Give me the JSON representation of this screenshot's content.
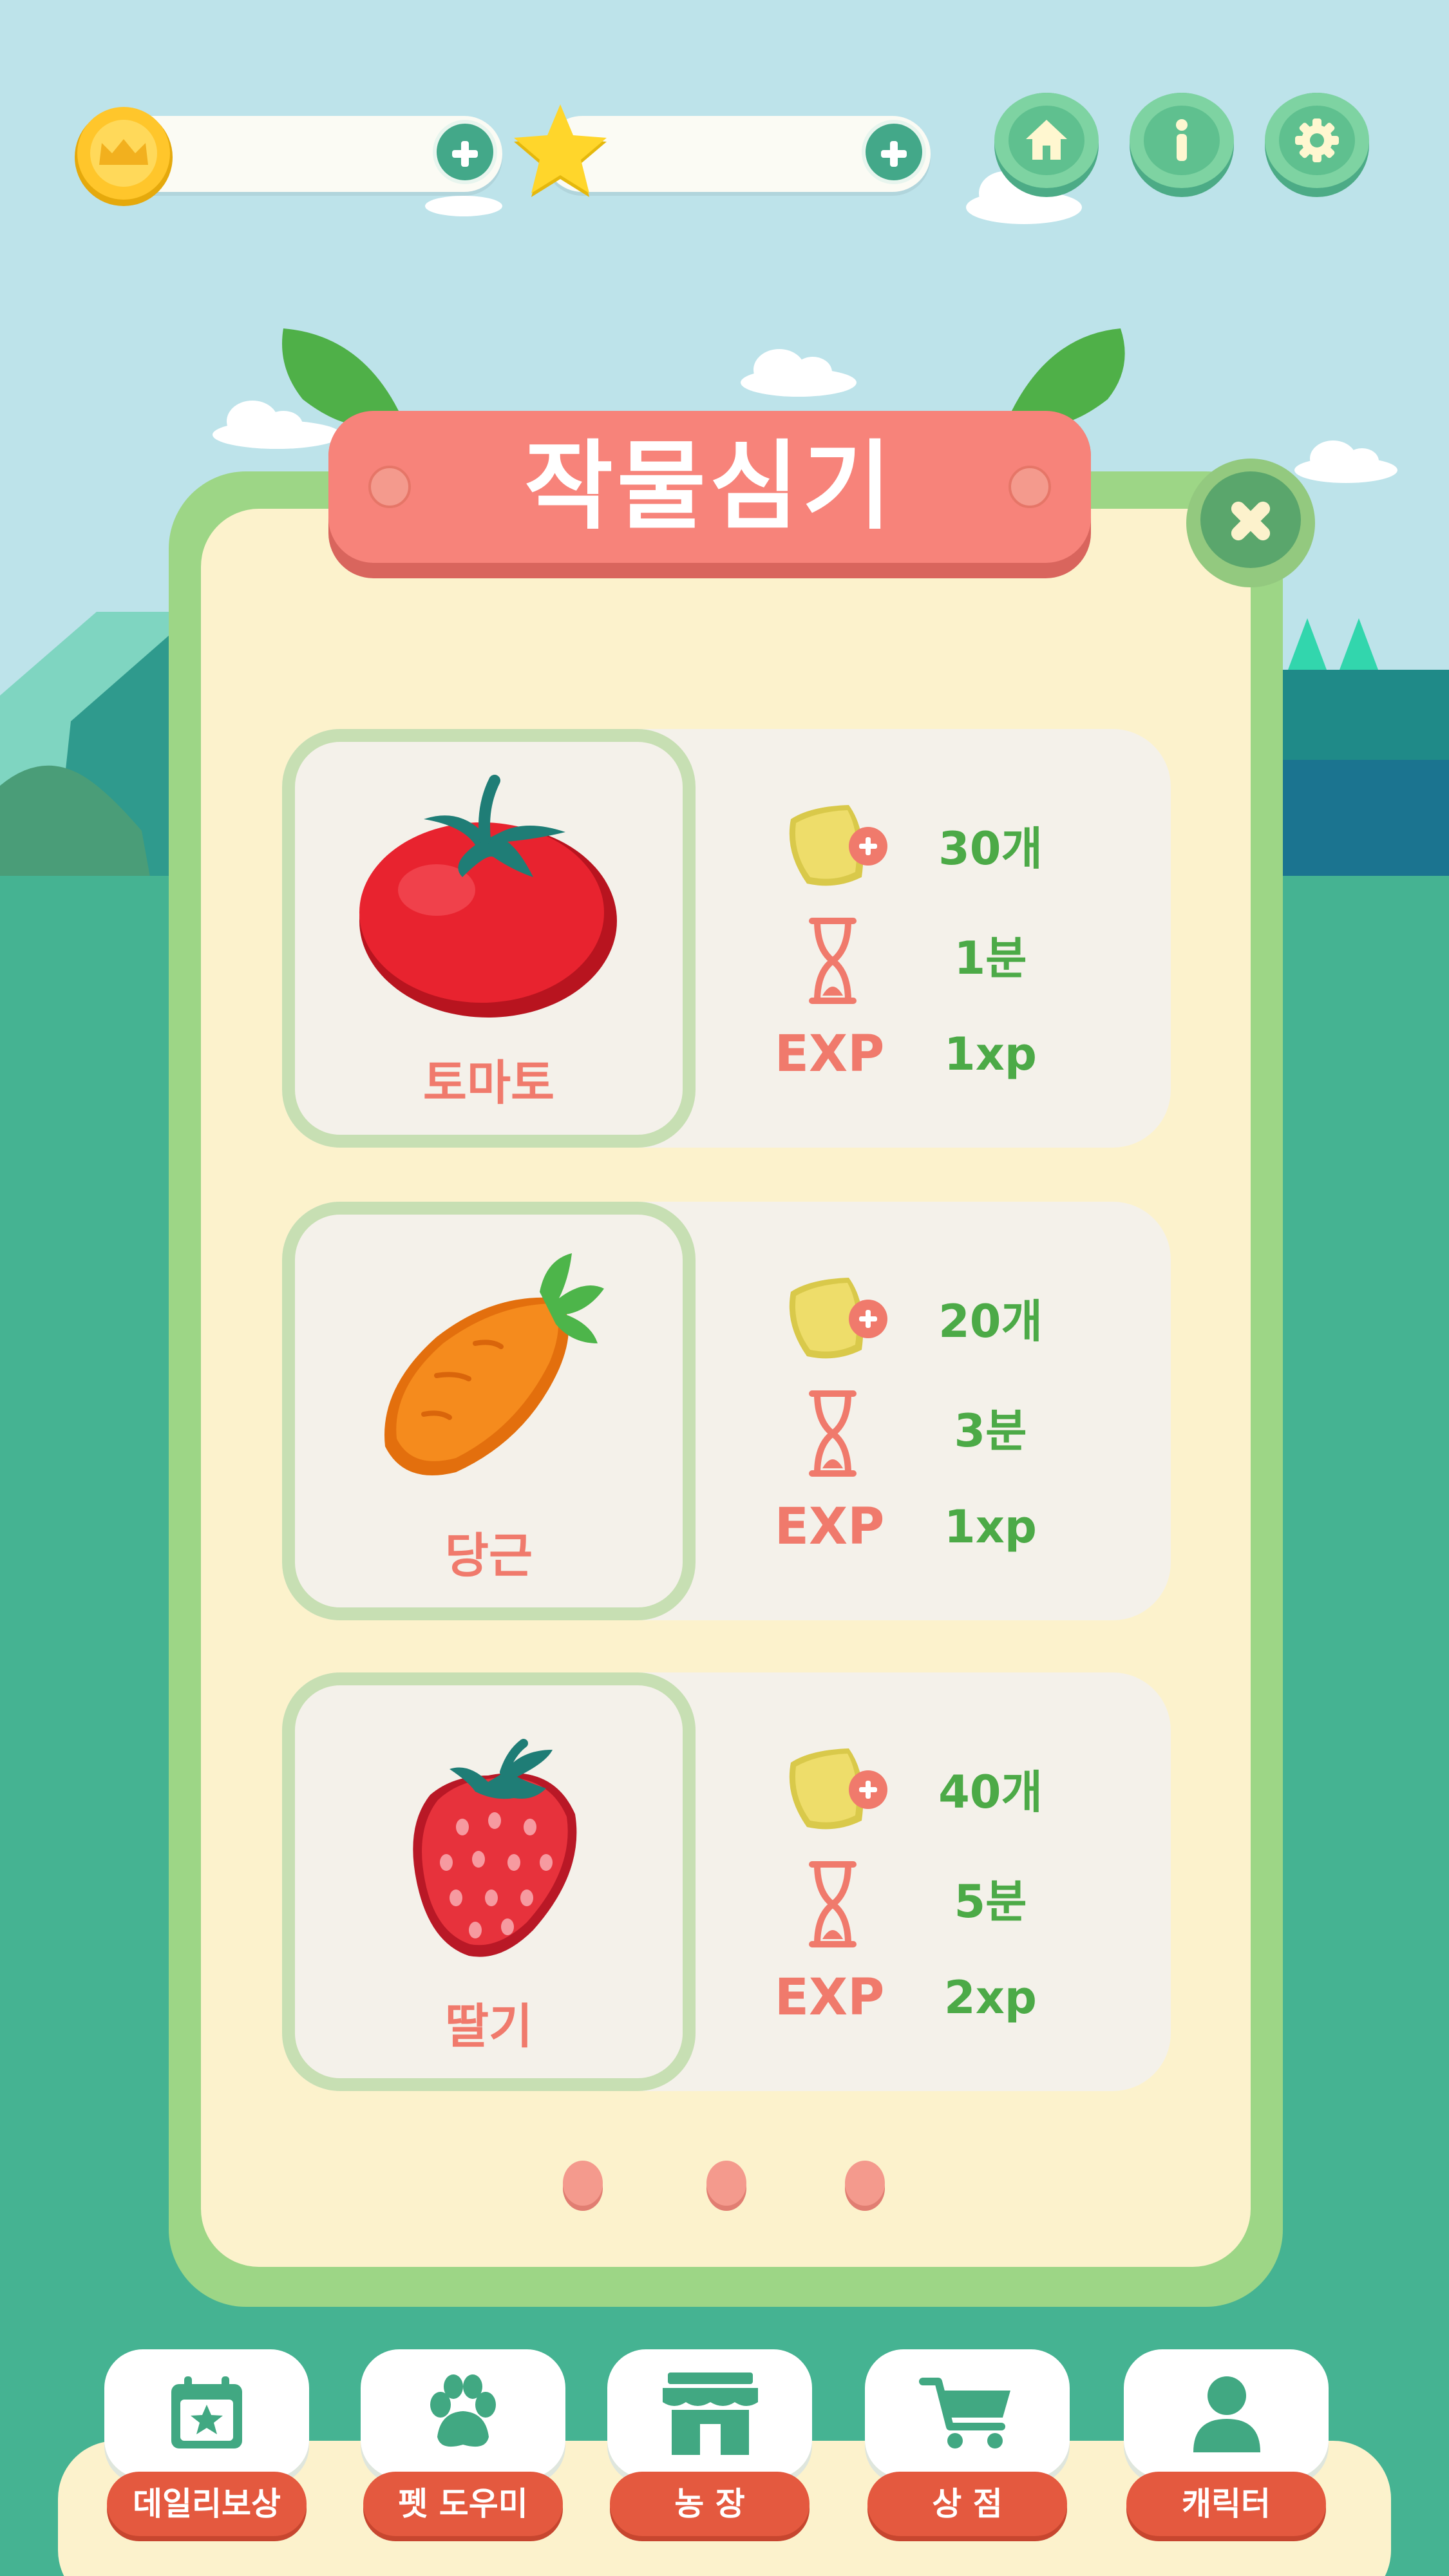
{
  "title": "작물심기",
  "colors": {
    "sky": "#bde3ea",
    "grass": "#45b392",
    "panel_border": "#9dd686",
    "panel_fill": "#fcf2cc",
    "title_plate": "#f7837a",
    "stat_green": "#4caa47",
    "stat_red": "#f07a6c",
    "nav_label": "#e4593f"
  },
  "hud": {
    "coin_icon": "crown-coin-icon",
    "star_icon": "star-icon",
    "buttons": [
      "home-icon",
      "info-icon",
      "gear-icon"
    ]
  },
  "crops": [
    {
      "name": "토마토",
      "seed": "30개",
      "time": "1분",
      "exp_label": "EXP",
      "exp": "1xp",
      "icon": "tomato-icon"
    },
    {
      "name": "당근",
      "seed": "20개",
      "time": "3분",
      "exp_label": "EXP",
      "exp": "1xp",
      "icon": "carrot-icon"
    },
    {
      "name": "딸기",
      "seed": "40개",
      "time": "5분",
      "exp_label": "EXP",
      "exp": "2xp",
      "icon": "strawberry-icon"
    }
  ],
  "pager": {
    "pages": 3
  },
  "nav": [
    {
      "label": "데일리보상",
      "icon": "calendar-star-icon"
    },
    {
      "label": "펫 도우미",
      "icon": "paw-icon"
    },
    {
      "label": "농 장",
      "icon": "shop-icon"
    },
    {
      "label": "상 점",
      "icon": "cart-icon"
    },
    {
      "label": "캐릭터",
      "icon": "person-icon"
    }
  ]
}
